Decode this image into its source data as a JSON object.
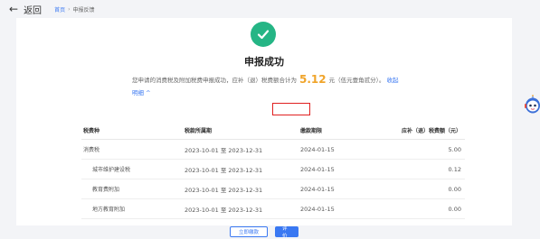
{
  "nav": {
    "back_label": "返回",
    "breadcrumb_home": "首页",
    "breadcrumb_separator": "›",
    "breadcrumb_current": "申报反馈"
  },
  "result": {
    "title": "申报成功",
    "summary_prefix": "您申请的消费税及附加税费申报成功，应补（退）税费额合计为",
    "amount": "5.12",
    "summary_suffix": "元（伍元壹角贰分）。",
    "toggle_label": "收起明细",
    "toggle_icon": "chevron-up-icon"
  },
  "table": {
    "headers": [
      "税费种",
      "税款所属期",
      "缴款期限",
      "应补（退）税费额（元）"
    ],
    "rows": [
      {
        "name": "消费税",
        "period": "2023-10-01 至 2023-12-31",
        "deadline": "2024-01-15",
        "amount": "5.00"
      },
      {
        "name": "城市维护建设税",
        "period": "2023-10-01 至 2023-12-31",
        "deadline": "2024-01-15",
        "amount": "0.12"
      },
      {
        "name": "教育费附加",
        "period": "2023-10-01 至 2023-12-31",
        "deadline": "2024-01-15",
        "amount": "0.00"
      },
      {
        "name": "地方教育附加",
        "period": "2023-10-01 至 2023-12-31",
        "deadline": "2024-01-15",
        "amount": "0.00"
      }
    ]
  },
  "actions": {
    "pay_label": "立即缴款",
    "rate_label": "评价"
  },
  "colors": {
    "success": "#25b585",
    "accent": "#3a78f2",
    "amount": "#f0a42a",
    "highlight": "#e02020"
  }
}
